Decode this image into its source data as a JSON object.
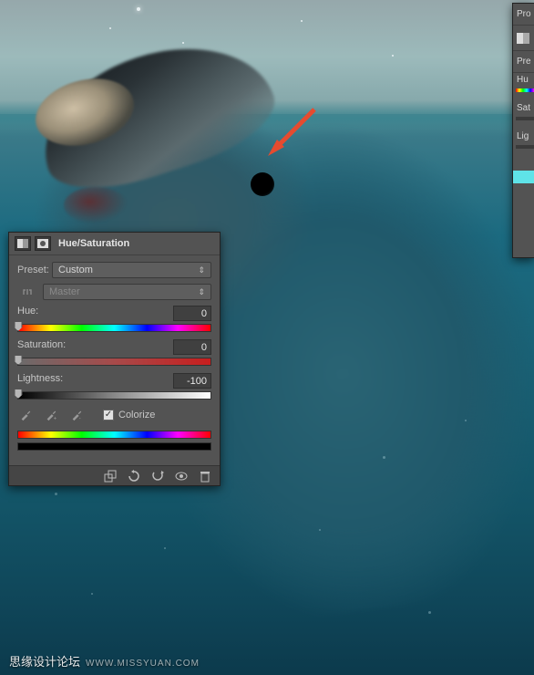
{
  "panel": {
    "title": "Hue/Saturation",
    "preset_label": "Preset:",
    "preset_value": "Custom",
    "range_value": "Master",
    "hue": {
      "label": "Hue:",
      "value": "0"
    },
    "saturation": {
      "label": "Saturation:",
      "value": "0"
    },
    "lightness": {
      "label": "Lightness:",
      "value": "-100"
    },
    "colorize_label": "Colorize",
    "colorize_checked": true
  },
  "right_panel": {
    "tab1": "Pro",
    "tab2": "Pre",
    "hue": "Hu",
    "sat": "Sat",
    "light": "Lig"
  },
  "watermark": {
    "main": "思缘设计论坛",
    "sub": "WWW.MISSYUAN.COM"
  }
}
